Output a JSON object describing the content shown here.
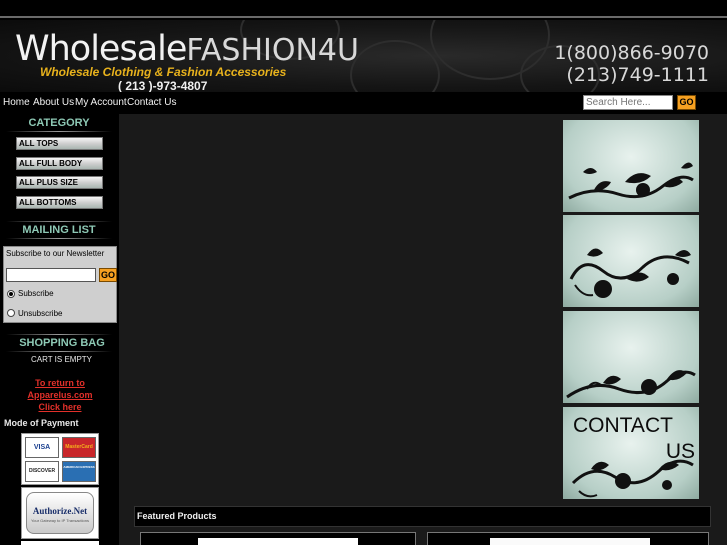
{
  "header": {
    "brand_main": "Wholesale",
    "brand_accent": "FASHION4U",
    "tagline": "Wholesale Clothing & Fashion Accessories",
    "local_phone": "( 213 )-973-4807",
    "phone_1": "1(800)866-9070",
    "phone_2": "(213)749-1111"
  },
  "nav": {
    "items": [
      "Home",
      "About Us",
      "My Account",
      "Contact Us"
    ],
    "search_placeholder": "Search Here...",
    "search_go": "GO"
  },
  "sidebar": {
    "category_title": "CATEGORY",
    "categories": [
      "ALL TOPS",
      "ALL FULL BODY",
      "ALL PLUS SIZE",
      "ALL BOTTOMS"
    ],
    "mailing_title": "MAILING LIST",
    "mailing_label": "Subscribe to our Newsletter",
    "mailing_go": "GO",
    "subscribe_label": "Subscribe",
    "unsubscribe_label": "Unsubscribe",
    "bag_title": "SHOPPING BAG",
    "cart_status": "CART IS EMPTY",
    "return_link": "To return to Apparelus.com Click here",
    "payment_title": "Mode of Payment",
    "cards": [
      "VISA",
      "MasterCard",
      "DISCOVER",
      "AMERICAN EXPRESS"
    ],
    "authorize_name": "Authorize.Net",
    "authorize_sub": "Your Gateway to IP Transactions"
  },
  "banners": {
    "contact_line1": "CONTACT",
    "contact_line2": "US"
  },
  "featured": {
    "label": "Featured Products"
  },
  "colors": {
    "accent_gold": "#e8b21c",
    "section_teal": "#8ec9b5",
    "go_orange": "#f5a021",
    "link_red": "#e2302a"
  }
}
